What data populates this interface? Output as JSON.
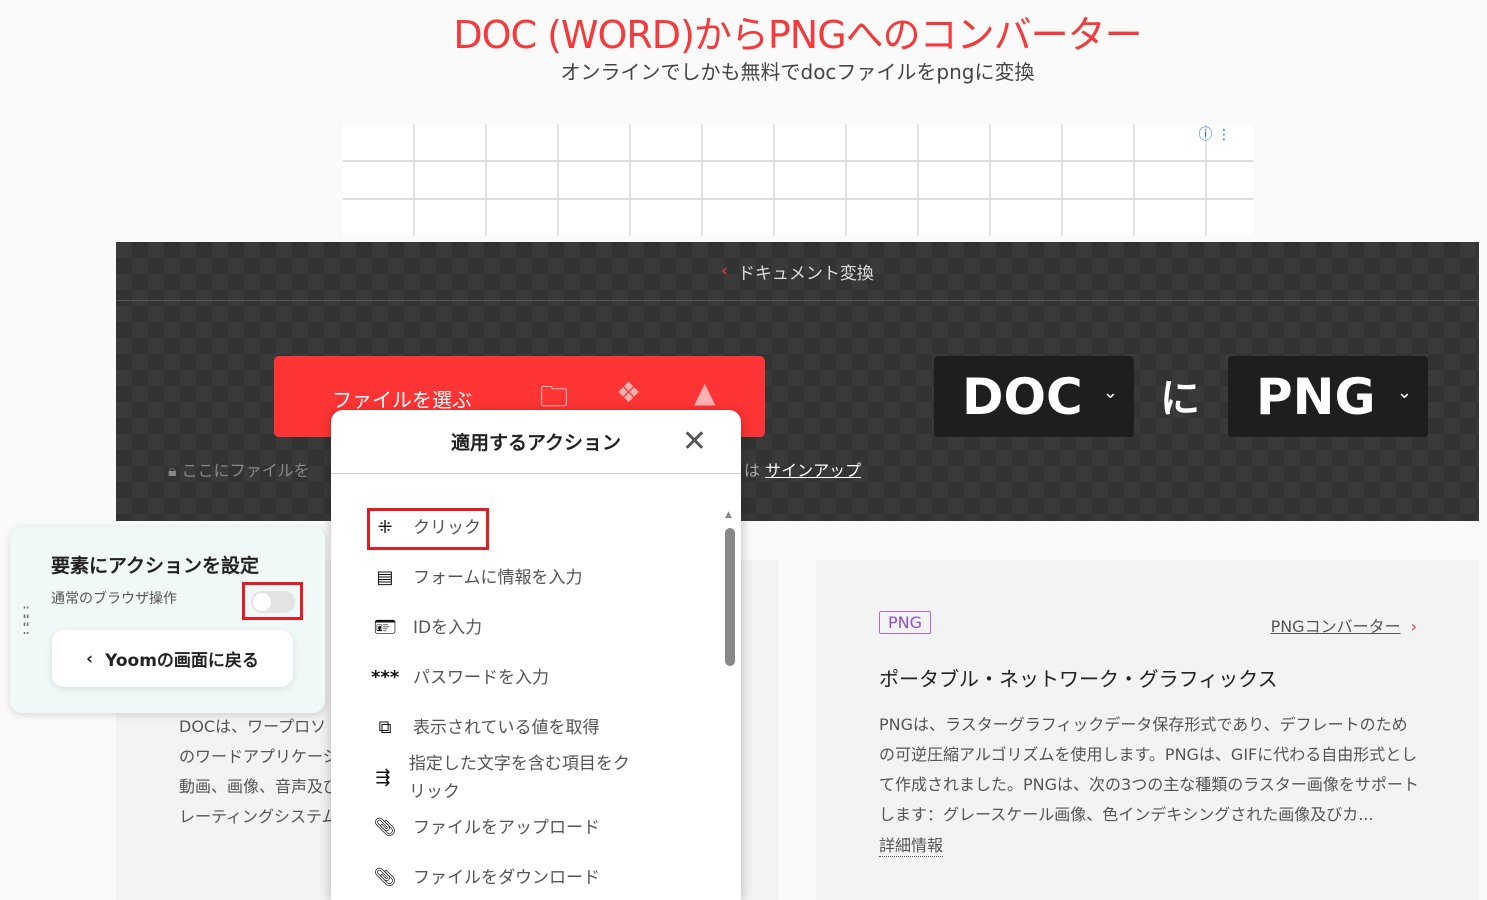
{
  "header": {
    "title": "DOC (WORD)からPNGへのコンバーター",
    "subtitle": "オンラインでしかも無料でdocファイルをpngに変換"
  },
  "ad": {
    "info_icon": "ⓘ ⋮"
  },
  "converter": {
    "breadcrumb": "ドキュメント変換",
    "choose_file_label": "ファイルを選ぶ",
    "from_format": "DOC",
    "to_word": "に",
    "to_format": "PNG",
    "drop_text": "ここにファイルを",
    "signup_prefix": "は",
    "signup_link": "サインアップ"
  },
  "doc_card": {
    "lines": [
      "DOCは、ワープロソ",
      "のワードアプリケーシ",
      "動画、画像、音声及び",
      "レーティングシステム"
    ]
  },
  "png_card": {
    "badge": "PNG",
    "converter_link": "PNGコンバーター",
    "title": "ポータブル・ネットワーク・グラフィックス",
    "description": "PNGは、ラスターグラフィックデータ保存形式であり、デフレートのための可逆圧縮アルゴリズムを使用します。PNGは、GIFに代わる自由形式として作成されました。PNGは、次の3つの主な種類のラスター画像をサポートします：グレースケール画像、色インデキシングされた画像及びカ...",
    "more": "詳細情報"
  },
  "action_modal": {
    "title": "適用するアクション",
    "items": [
      {
        "label": "クリック",
        "icon": "click-icon"
      },
      {
        "label": "フォームに情報を入力",
        "icon": "form-icon"
      },
      {
        "label": "IDを入力",
        "icon": "id-card-icon"
      },
      {
        "label": "パスワードを入力",
        "icon": "password-icon"
      },
      {
        "label": "表示されている値を取得",
        "icon": "copy-icon"
      },
      {
        "label": "指定した文字を含む項目をクリック",
        "icon": "text-click-icon"
      },
      {
        "label": "ファイルをアップロード",
        "icon": "upload-icon"
      },
      {
        "label": "ファイルをダウンロード",
        "icon": "download-icon"
      }
    ]
  },
  "yoom_panel": {
    "title": "要素にアクションを設定",
    "toggle_label": "通常のブラウザ操作",
    "toggle_on": false,
    "back_button": "Yoomの画面に戻る"
  }
}
